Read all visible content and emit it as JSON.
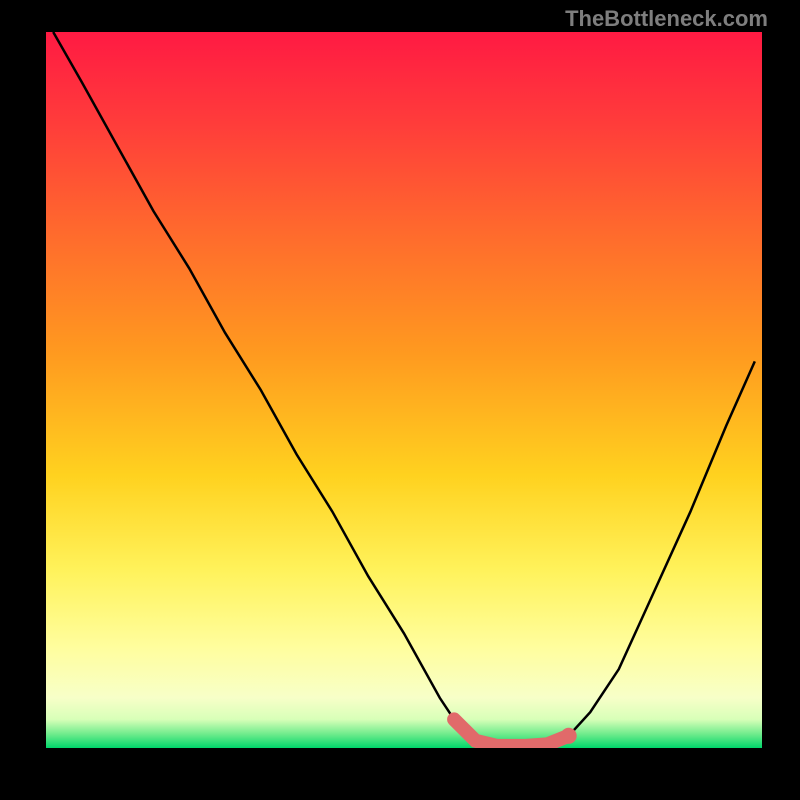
{
  "watermark": "TheBottleneck.com",
  "chart_data": {
    "type": "line",
    "title": "",
    "xlabel": "",
    "ylabel": "",
    "xlim": [
      0,
      100
    ],
    "ylim": [
      0,
      100
    ],
    "series": [
      {
        "name": "curve",
        "x": [
          1,
          5,
          10,
          15,
          20,
          25,
          30,
          35,
          40,
          45,
          50,
          55,
          57,
          60,
          63,
          67,
          70,
          73,
          76,
          80,
          85,
          90,
          95,
          99
        ],
        "y": [
          100,
          93,
          84,
          75,
          67,
          58,
          50,
          41,
          33,
          24,
          16,
          7,
          4,
          1,
          0.3,
          0.3,
          0.5,
          1.7,
          5,
          11,
          22,
          33,
          45,
          54
        ]
      }
    ],
    "highlight": {
      "name": "trough",
      "x_range": [
        57,
        73
      ],
      "style": "thick-salmon",
      "end_dot_x": 73
    },
    "background": "vertical-gradient red→orange→yellow→green"
  }
}
